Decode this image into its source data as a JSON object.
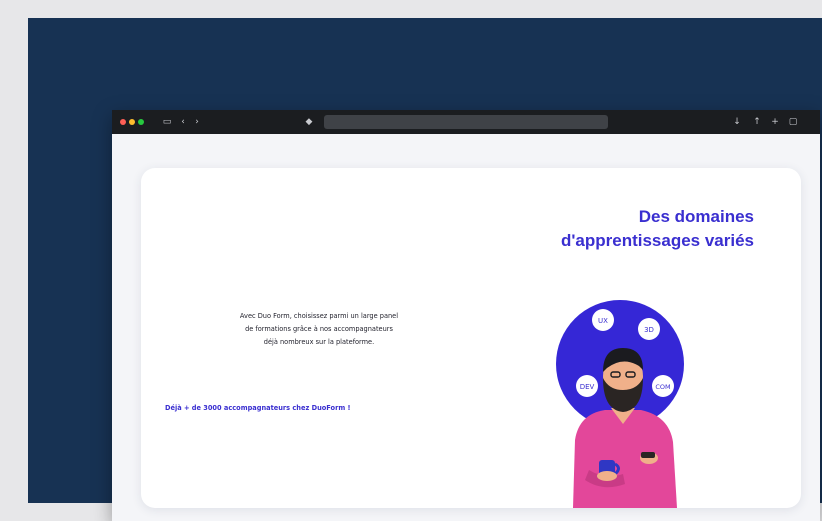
{
  "browser": {
    "traffic_light_colors": [
      "#ff5f56",
      "#ffbd2e",
      "#27c93f"
    ],
    "nav_icons": [
      "sidebar-icon",
      "back-icon",
      "forward-icon"
    ],
    "right_icons": [
      "download-icon",
      "share-icon",
      "new-tab-icon",
      "tabs-icon"
    ]
  },
  "hero": {
    "title_line1": "Des domaines",
    "title_line2": "d'apprentissages variés",
    "description_line1": "Avec Duo Form, choisissez parmi un large panel",
    "description_line2": "de formations grâce à nos accompagnateurs",
    "description_line3": "déjà nombreux sur la plateforme.",
    "highlight": "Déjà + de 3000 accompagnateurs chez DuoForm !"
  },
  "illustration": {
    "bubbles": [
      "UX",
      "3D",
      "DEV",
      "COM"
    ],
    "circle_color": "#3527d6",
    "shirt_color": "#e3479a",
    "mug_color": "#2f37c4"
  }
}
